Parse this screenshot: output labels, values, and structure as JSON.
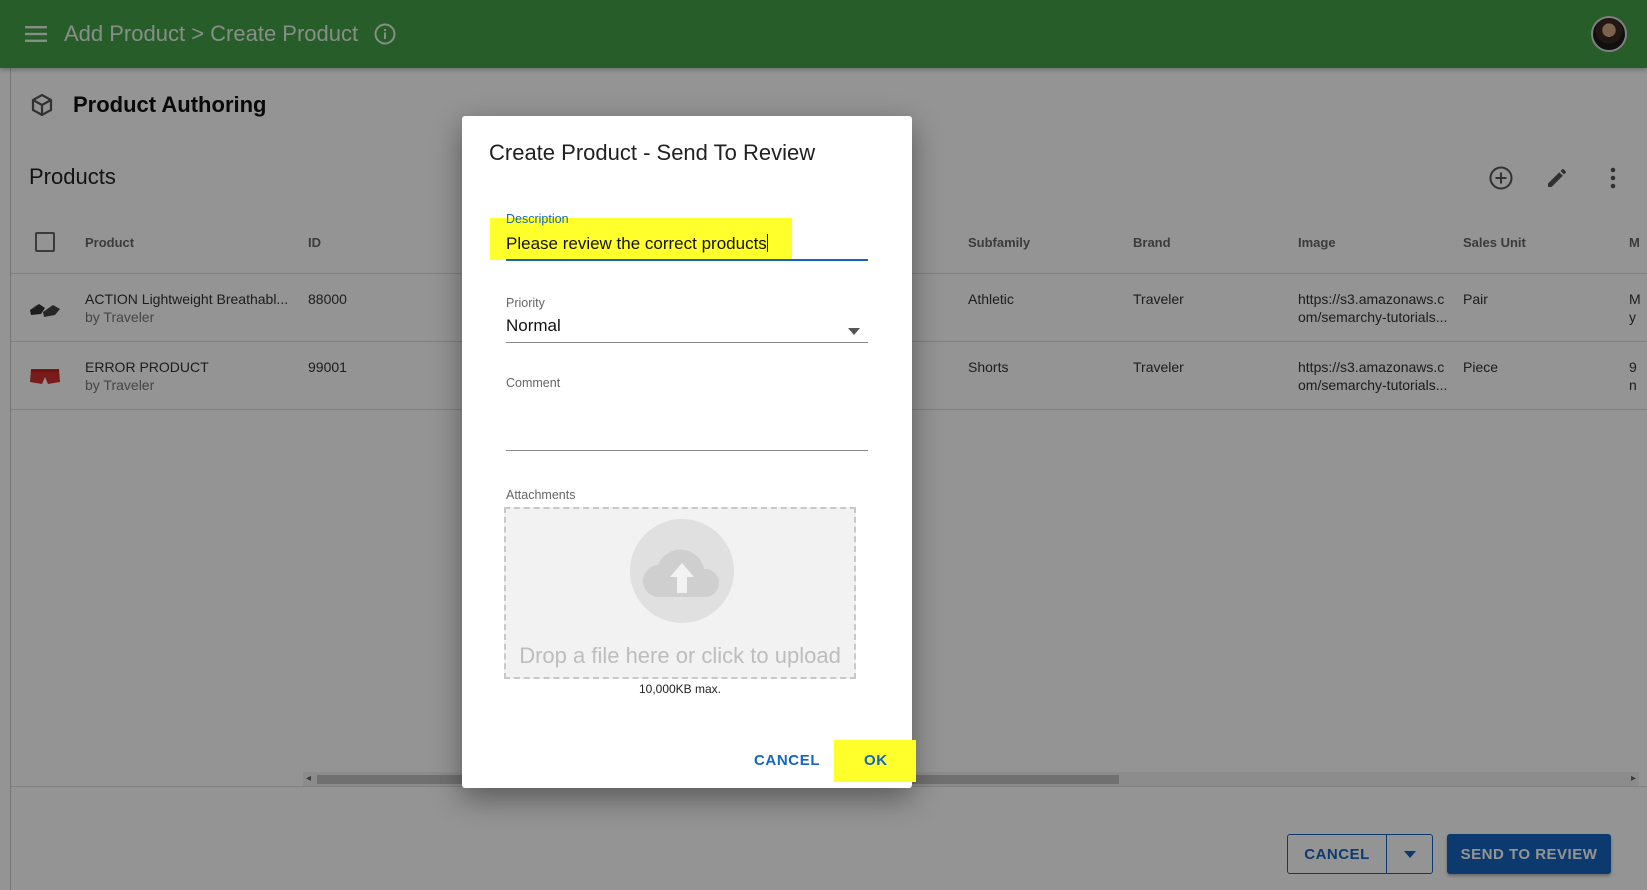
{
  "appbar": {
    "title": "Add Product > Create Product",
    "menu_icon": "hamburger-menu-icon",
    "info_icon": "info-icon"
  },
  "page": {
    "section_title": "Product Authoring",
    "products_title": "Products"
  },
  "table": {
    "headers": [
      "Product",
      "ID",
      "Subfamily",
      "Brand",
      "Image",
      "Sales Unit",
      "M"
    ],
    "rows": [
      {
        "name": "ACTION Lightweight Breathabl...",
        "by": "by Traveler",
        "id": "88000",
        "subfamily": "Athletic",
        "brand": "Traveler",
        "image_1": "https://s3.amazonaws.c",
        "image_2": "om/semarchy-tutorials...",
        "sales_unit": "Pair",
        "m_1": "M",
        "m_2": "y"
      },
      {
        "name": "ERROR PRODUCT",
        "by": "by Traveler",
        "id": "99001",
        "subfamily": "Shorts",
        "brand": "Traveler",
        "image_1": "https://s3.amazonaws.c",
        "image_2": "om/semarchy-tutorials...",
        "sales_unit": "Piece",
        "m_1": "9",
        "m_2": "n"
      }
    ]
  },
  "footer": {
    "cancel_label": "CANCEL",
    "send_label": "SEND TO REVIEW"
  },
  "dialog": {
    "title": "Create Product - Send To Review",
    "description_label": "Description",
    "description_value": "Please review the correct products",
    "priority_label": "Priority",
    "priority_value": "Normal",
    "comment_label": "Comment",
    "comment_value": "",
    "attachments_label": "Attachments",
    "dropzone_text": "Drop a file here or click to upload",
    "max_size": "10,000KB max.",
    "cancel_label": "CANCEL",
    "ok_label": "OK"
  },
  "colors": {
    "appbar": "#43a047",
    "primary": "#1565c0",
    "highlight": "#ffff2b"
  }
}
